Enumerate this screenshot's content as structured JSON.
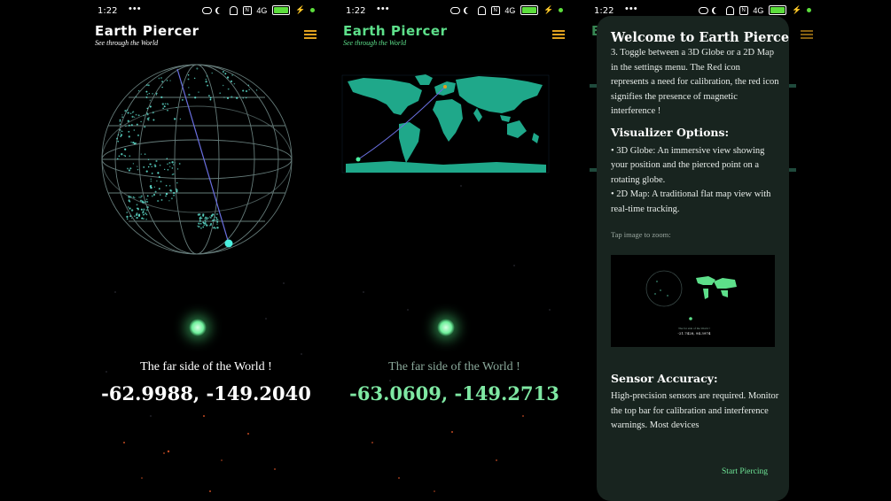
{
  "status": {
    "time": "1:22",
    "dots": "•••",
    "signal": "4G",
    "nfc": "N"
  },
  "app": {
    "title": "Earth Piercer",
    "subtitle": "See through the World"
  },
  "screens": [
    {
      "caption": "The far side of the World !",
      "coords": "-62.9988, -149.2040",
      "view": "3D Globe"
    },
    {
      "caption": "The far side of the World !",
      "coords": "-63.0609, -149.2713",
      "view": "2D Map"
    }
  ],
  "modal": {
    "title": "Welcome to Earth Piercer!",
    "intro_clipped": "3. Toggle between a 3D Globe or a 2D Map in the settings menu.  The Red icon represents a need for calibration, the red icon signifies the presence of magnetic interference !",
    "visualizer_heading": "Visualizer Options:",
    "visualizer_globe": "• 3D Globe: An immersive view showing your position and the pierced point on a rotating globe.",
    "visualizer_map": "• 2D Map: A traditional flat map view with real-time tracking.",
    "zoom_hint": "Tap image to zoom:",
    "thumb_caption": "The far side of the World !",
    "thumb_coords": "-21.7428, 94.3974",
    "sensor_heading": "Sensor Accuracy:",
    "sensor_text": "High-precision sensors are required. Monitor the top bar for calibration and interference warnings. Most devices",
    "start_button": "Start Piercing"
  },
  "colors": {
    "accent_green": "#5ddf8a",
    "menu_orange": "#e0a11f",
    "modal_bg": "#18241f",
    "map_teal": "#1fa88a",
    "globe_cyan": "#4fd6c8"
  },
  "icons": [
    "link-icon",
    "moon-icon",
    "bell-off-icon",
    "nfc-icon",
    "signal-icon",
    "battery-icon",
    "charging-icon",
    "menu-icon"
  ]
}
